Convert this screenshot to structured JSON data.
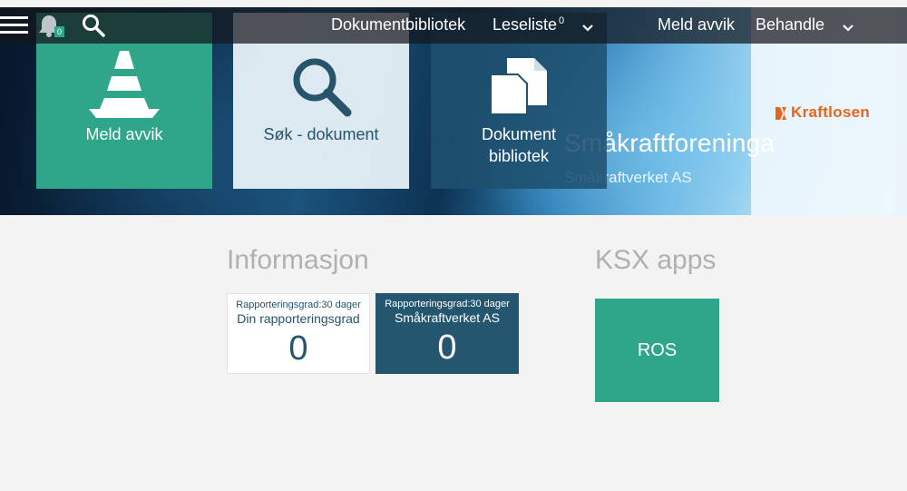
{
  "nav": {
    "notification_count": "0",
    "links": {
      "dokumentbibliotek": "Dokumentbibliotek",
      "leseliste": "Leseliste",
      "leseliste_count": "0",
      "meld_avvik": "Meld avvik",
      "behandle": "Behandle"
    }
  },
  "banner": {
    "org_title": "Småkraftforeninga",
    "org_subtitle": "Småkraftverket AS",
    "brand_logo_text": "Kraftlosen",
    "colors": {
      "accent_green": "#2fa58a",
      "dark_teal": "#245670",
      "logo_orange": "#e8631c"
    }
  },
  "tiles": [
    {
      "label": "Meld avvik",
      "icon": "traffic-cone-icon"
    },
    {
      "label": "Søk - dokument",
      "icon": "search-icon"
    },
    {
      "label": "Dokument bibliotek",
      "icon": "documents-icon"
    }
  ],
  "info": {
    "title": "Informasjon",
    "cards": [
      {
        "caption": "Rapporteringsgrad:30 dager",
        "name": "Din rapporteringsgrad",
        "value": "0"
      },
      {
        "caption": "Rapporteringsgrad:30 dager",
        "name": "Småkraftverket AS",
        "value": "0"
      }
    ]
  },
  "apps": {
    "title": "KSX apps",
    "items": [
      {
        "label": "ROS"
      }
    ]
  }
}
